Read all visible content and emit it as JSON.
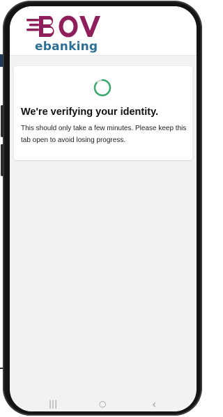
{
  "app": {
    "logo_text": "BOV",
    "logo_subtext": "ebanking"
  },
  "status_card": {
    "title": "We're verifying your identity.",
    "message": "This should only take a few minutes. Please keep this tab open to avoid losing progress."
  },
  "nav": {
    "recent_icon": "|||",
    "home_icon": "○",
    "back_icon": "‹"
  },
  "colors": {
    "brand_magenta": "#8e1f5a",
    "brand_blue": "#2d6f95",
    "spinner_green": "#3aa86b",
    "screen_bg": "#f2f2f2"
  },
  "icons": [
    "spinner-icon",
    "recent-apps-icon",
    "home-icon",
    "back-icon"
  ]
}
